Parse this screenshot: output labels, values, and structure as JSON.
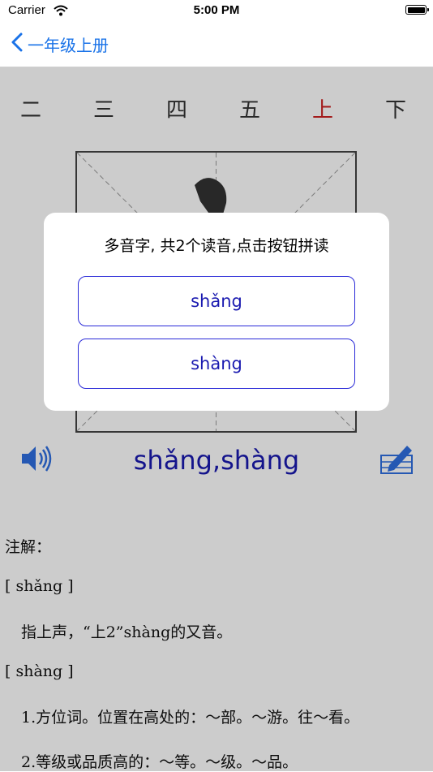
{
  "status_bar": {
    "carrier": "Carrier",
    "time": "5:00 PM"
  },
  "nav": {
    "back_label": "一年级上册"
  },
  "tabs": [
    {
      "label": "二"
    },
    {
      "label": "三"
    },
    {
      "label": "四"
    },
    {
      "label": "五"
    },
    {
      "label": "上"
    },
    {
      "label": "下"
    }
  ],
  "character": {
    "pinyin": "shǎng,shàng"
  },
  "definition": {
    "heading": "注解：",
    "entries": [
      {
        "reading": "[ shǎng ]",
        "lines": [
          "指上声，“上2”shàng的又音。"
        ]
      },
      {
        "reading": "[ shàng ]",
        "lines": [
          "1.方位词。位置在高处的：～部。～游。往～看。",
          "2.等级或品质高的：～等。～级。～品。"
        ]
      }
    ]
  },
  "dialog": {
    "title": "多音字, 共2个读音,点击按钮拼读",
    "options": [
      "shǎng",
      "shàng"
    ]
  },
  "colors": {
    "accent": "#1a73e8",
    "active_tab": "#cc2222",
    "pinyin": "#1a1ab0",
    "dialog_border": "#2a2ad8",
    "icon_blue": "#2f6fe0"
  },
  "icons": [
    "back-chevron-icon",
    "wifi-icon",
    "battery-icon",
    "speaker-icon",
    "edit-pencil-icon"
  ]
}
